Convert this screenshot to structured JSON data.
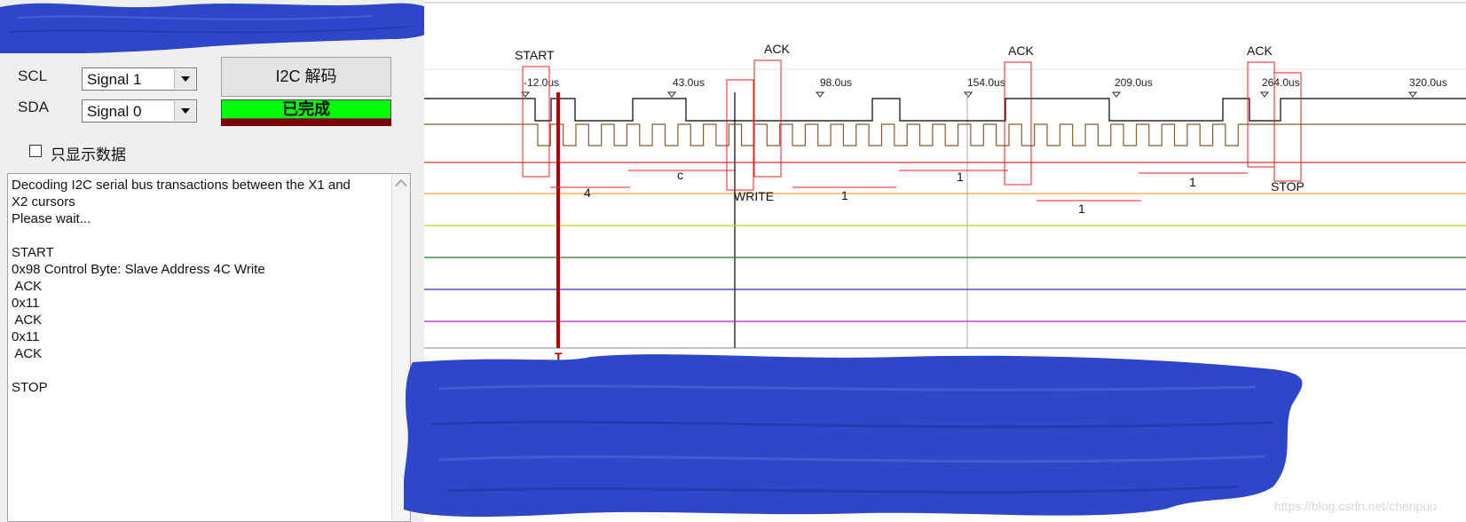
{
  "left_panel": {
    "scl_label": "SCL",
    "sda_label": "SDA",
    "scl_select_value": "Signal 1",
    "sda_select_value": "Signal 0",
    "decode_button_label": "I2C 解码",
    "status_text": "已完成",
    "show_data_only_label": "只显示数据",
    "log_lines": [
      "Decoding I2C serial bus transactions between the X1 and",
      "X2 cursors",
      "Please wait...",
      "",
      "START",
      "0x98 Control Byte: Slave Address 4C Write",
      " ACK",
      "0x11",
      " ACK",
      "0x11",
      " ACK",
      "",
      "STOP"
    ]
  },
  "waveform": {
    "time_ticks": [
      "-12.0us",
      "43.0us",
      "98.0us",
      "154.0us",
      "209.0us",
      "264.0us",
      "320.0us"
    ],
    "trigger_label": "T",
    "annotations": {
      "start": "START",
      "ack1": "ACK",
      "ack2": "ACK",
      "ack3": "ACK",
      "stop": "STOP",
      "write": "WRITE",
      "nibble_4": "4",
      "nibble_c": "c",
      "bits_1a": "1",
      "bits_1b": "1",
      "bits_1c": "1",
      "bits_1d": "1"
    },
    "colors": {
      "scl": "#000000",
      "sda": "#8b5a2b",
      "ch2": "#e03030",
      "ch3": "#f0a030",
      "ch4": "#d8c820",
      "ch5": "#208020",
      "ch6": "#3030c0",
      "ch7": "#c020c0",
      "trigger": "#b00000",
      "annotation_box": "#ee2222"
    }
  },
  "watermark_text": "https://blog.csdn.net/chenpuo"
}
